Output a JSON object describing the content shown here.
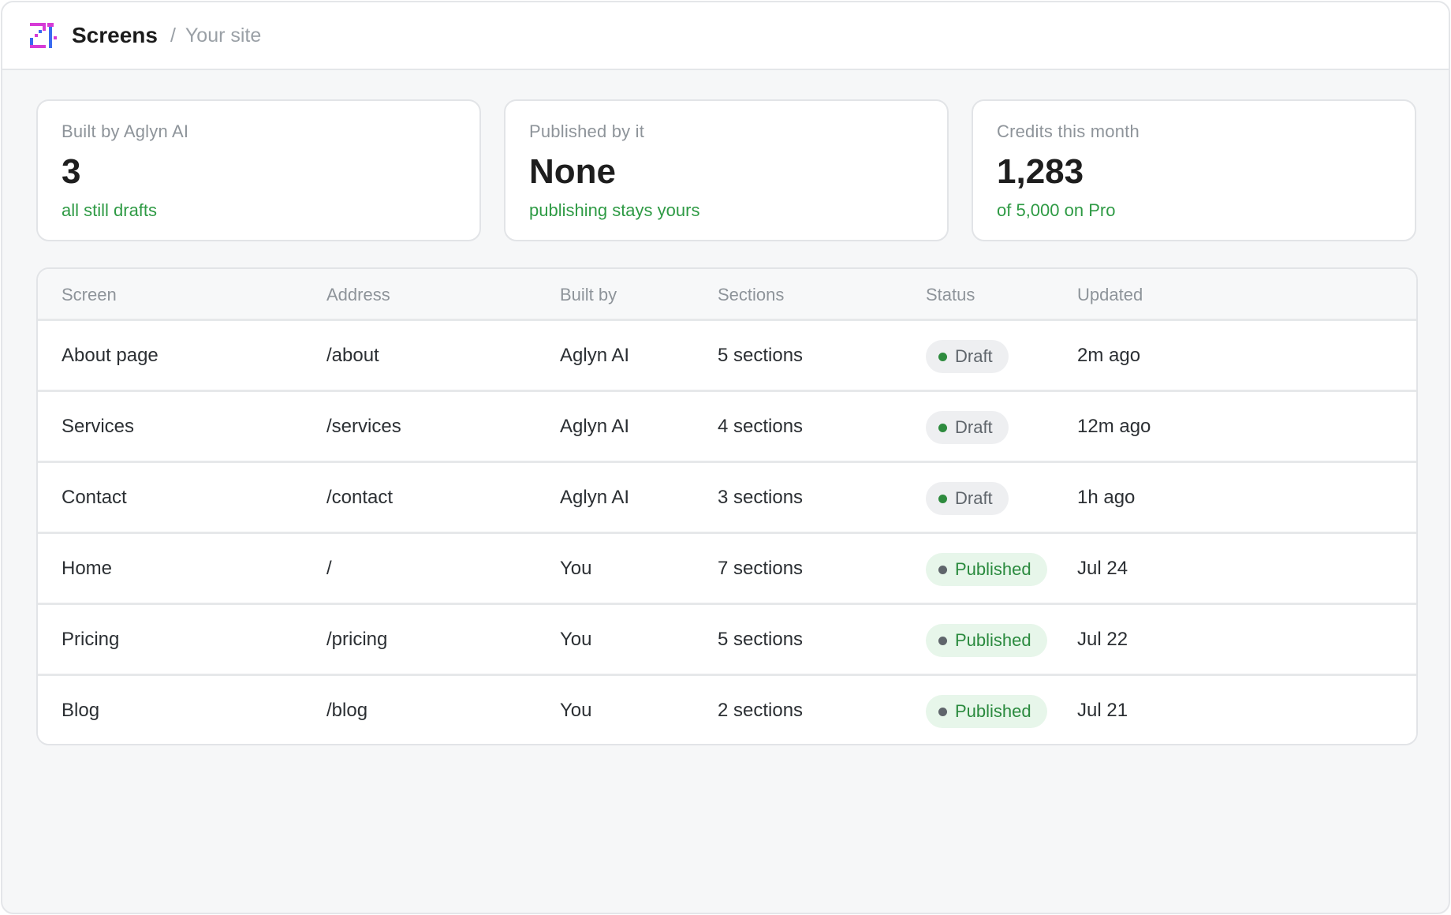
{
  "header": {
    "title": "Screens",
    "separator": "/",
    "crumb": "Your site",
    "logo_icon": "pixel-brand-logo"
  },
  "stats": [
    {
      "label": "Built by Aglyn AI",
      "value": "3",
      "note": "all still drafts"
    },
    {
      "label": "Published by it",
      "value": "None",
      "note": "publishing stays yours"
    },
    {
      "label": "Credits this month",
      "value": "1,283",
      "note": "of 5,000 on Pro"
    }
  ],
  "table": {
    "columns": [
      "Screen",
      "Address",
      "Built by",
      "Sections",
      "Status",
      "Updated"
    ],
    "rows": [
      {
        "screen": "About page",
        "address": "/about",
        "built_by": "Aglyn AI",
        "sections": "5 sections",
        "status": "Draft",
        "updated": "2m ago"
      },
      {
        "screen": "Services",
        "address": "/services",
        "built_by": "Aglyn AI",
        "sections": "4 sections",
        "status": "Draft",
        "updated": "12m ago"
      },
      {
        "screen": "Contact",
        "address": "/contact",
        "built_by": "Aglyn AI",
        "sections": "3 sections",
        "status": "Draft",
        "updated": "1h ago"
      },
      {
        "screen": "Home",
        "address": "/",
        "built_by": "You",
        "sections": "7 sections",
        "status": "Published",
        "updated": "Jul 24"
      },
      {
        "screen": "Pricing",
        "address": "/pricing",
        "built_by": "You",
        "sections": "5 sections",
        "status": "Published",
        "updated": "Jul 22"
      },
      {
        "screen": "Blog",
        "address": "/blog",
        "built_by": "You",
        "sections": "2 sections",
        "status": "Published",
        "updated": "Jul 21"
      }
    ]
  },
  "colors": {
    "accent_green": "#2e9a44",
    "draft_badge_bg": "#eeeff1",
    "published_badge_bg": "#e7f6ea",
    "logo_magenta": "#d63bd6",
    "logo_blue": "#3a6bf0"
  }
}
